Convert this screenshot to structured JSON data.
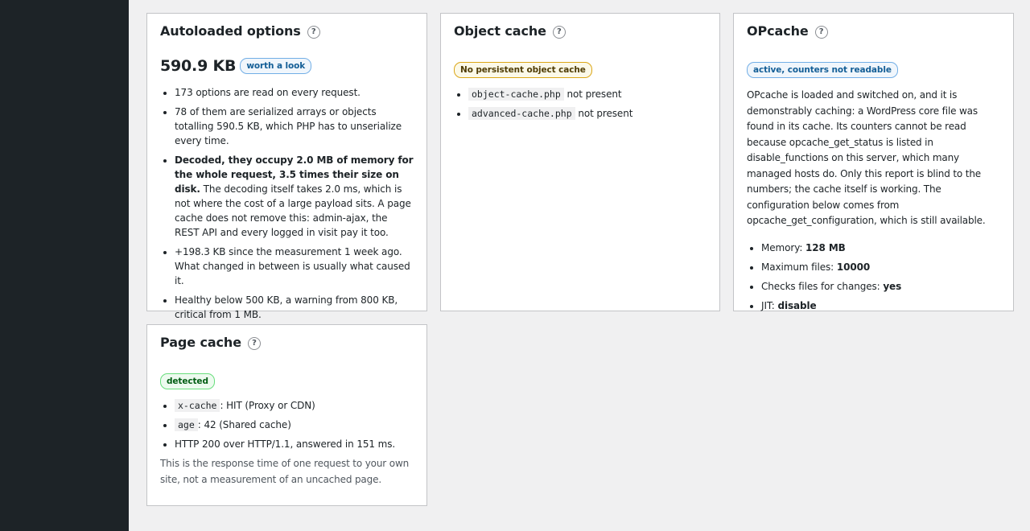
{
  "autoload": {
    "title": "Autoloaded options",
    "help": "?",
    "size": "590.9 KB",
    "badge": "worth a look",
    "items": [
      "173 options are read on every request.",
      "78 of them are serialized arrays or objects totalling 590.5 KB, which PHP has to unserialize every time.",
      "+198.3 KB since the measurement 1 week ago. What changed in between is usually what caused it.",
      "Healthy below 500 KB, a warning from 800 KB, critical from 1 MB."
    ],
    "decoded_bold": "Decoded, they occupy 2.0 MB of memory for the whole request, 3.5 times their size on disk.",
    "decoded_rest": " The decoding itself takes 2.0 ms, which is not where the cost of a large payload sits. A page cache does not remove this: admin-ajax, the REST API and every logged in visit pay it too."
  },
  "objcache": {
    "title": "Object cache",
    "help": "?",
    "badge": "No persistent object cache",
    "items": [
      {
        "code": "object-cache.php",
        "text": " not present"
      },
      {
        "code": "advanced-cache.php",
        "text": " not present"
      }
    ]
  },
  "opcache": {
    "title": "OPcache",
    "help": "?",
    "badge": "active, counters not readable",
    "description": "OPcache is loaded and switched on, and it is demonstrably caching: a WordPress core file was found in its cache. Its counters cannot be read because opcache_get_status is listed in disable_functions on this server, which many managed hosts do. Only this report is blind to the numbers; the cache itself is working. The configuration below comes from opcache_get_configuration, which is still available.",
    "items": [
      {
        "label": "Memory: ",
        "value": "128 MB"
      },
      {
        "label": "Maximum files: ",
        "value": "10000"
      },
      {
        "label": "Checks files for changes: ",
        "value": "yes"
      },
      {
        "label": "JIT: ",
        "value": "disable"
      }
    ]
  },
  "pagecache": {
    "title": "Page cache",
    "help": "?",
    "badge": "detected",
    "headers": [
      {
        "code": "x-cache",
        "text": ": HIT (Proxy or CDN)"
      },
      {
        "code": "age",
        "text": ": 42 (Shared cache)"
      }
    ],
    "http": "HTTP 200 over HTTP/1.1, answered in 151 ms.",
    "note": "This is the response time of one request to your own site, not a measurement of an uncached page."
  }
}
